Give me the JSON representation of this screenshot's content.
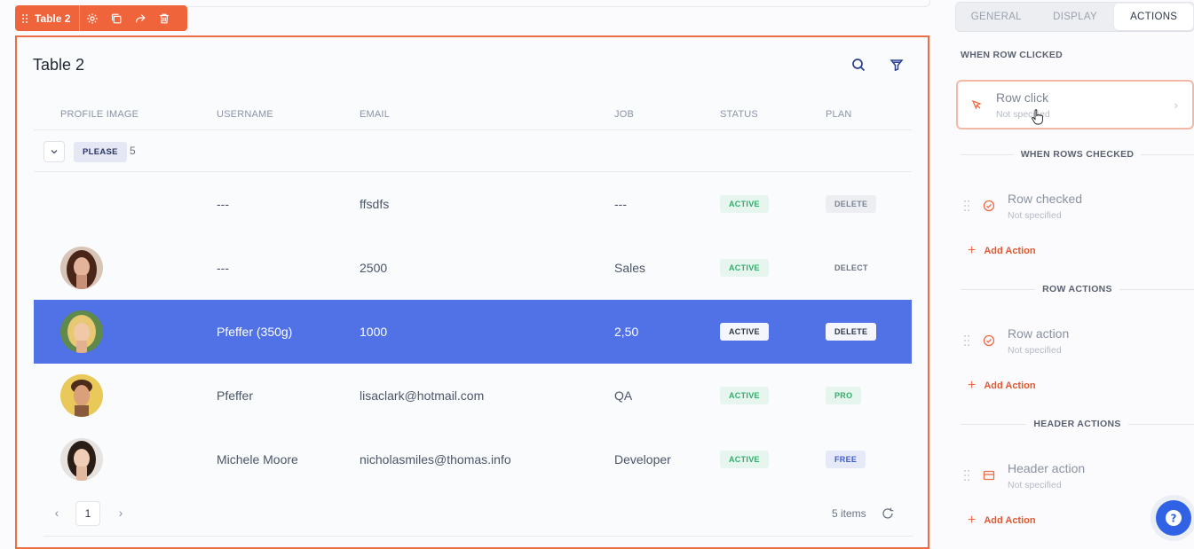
{
  "toolbar": {
    "widget_name": "Table 2",
    "icons": [
      "drag-handle-icon",
      "gear-icon",
      "duplicate-icon",
      "share-icon",
      "trash-icon"
    ]
  },
  "table": {
    "title": "Table 2",
    "columns": [
      "PROFILE IMAGE",
      "USERNAME",
      "EMAIL",
      "JOB",
      "STATUS",
      "PLAN"
    ],
    "group": {
      "label": "PLEASE",
      "count": "5"
    },
    "rows": [
      {
        "username": "---",
        "email": "ffsdfs",
        "job": "---",
        "status": "ACTIVE",
        "plan": "DELETE",
        "avatar": "none"
      },
      {
        "username": "---",
        "email": "2500",
        "job": "Sales",
        "status": "ACTIVE",
        "plan": "DELECT",
        "avatar": "woman-brown-hair"
      },
      {
        "username": "Pfeffer (350g)",
        "email": "1000",
        "job": "2,50",
        "status": "ACTIVE",
        "plan": "DELETE",
        "avatar": "woman-blonde",
        "selected": true
      },
      {
        "username": "Pfeffer",
        "email": "lisaclark@hotmail.com",
        "job": "QA",
        "status": "ACTIVE",
        "plan": "PRO",
        "avatar": "man-yellow-bg"
      },
      {
        "username": "Michele Moore",
        "email": "nicholasmiles@thomas.info",
        "job": "Developer",
        "status": "ACTIVE",
        "plan": "FREE",
        "avatar": "woman-dark-hair"
      }
    ],
    "pagination": {
      "prev": "‹",
      "page": "1",
      "next": "›",
      "items_label": "5 items"
    }
  },
  "panel": {
    "tabs": [
      "GENERAL",
      "DISPLAY",
      "ACTIONS"
    ],
    "active_tab": "ACTIONS",
    "sections": [
      {
        "title": "WHEN ROW CLICKED",
        "item": {
          "label": "Row click",
          "sub": "Not specified"
        }
      },
      {
        "title": "WHEN ROWS CHECKED",
        "item": {
          "label": "Row checked",
          "sub": "Not specified"
        },
        "add": "Add Action"
      },
      {
        "title": "ROW ACTIONS",
        "item": {
          "label": "Row action",
          "sub": "Not specified"
        },
        "add": "Add Action"
      },
      {
        "title": "HEADER ACTIONS",
        "item": {
          "label": "Header action",
          "sub": "Not specified"
        },
        "add": "Add Action"
      }
    ],
    "help_label": "?"
  },
  "colors": {
    "accent": "#f0643b",
    "selected_row": "#5172e7",
    "active_green": "#2fae6a",
    "help_blue": "#2f62e4"
  }
}
